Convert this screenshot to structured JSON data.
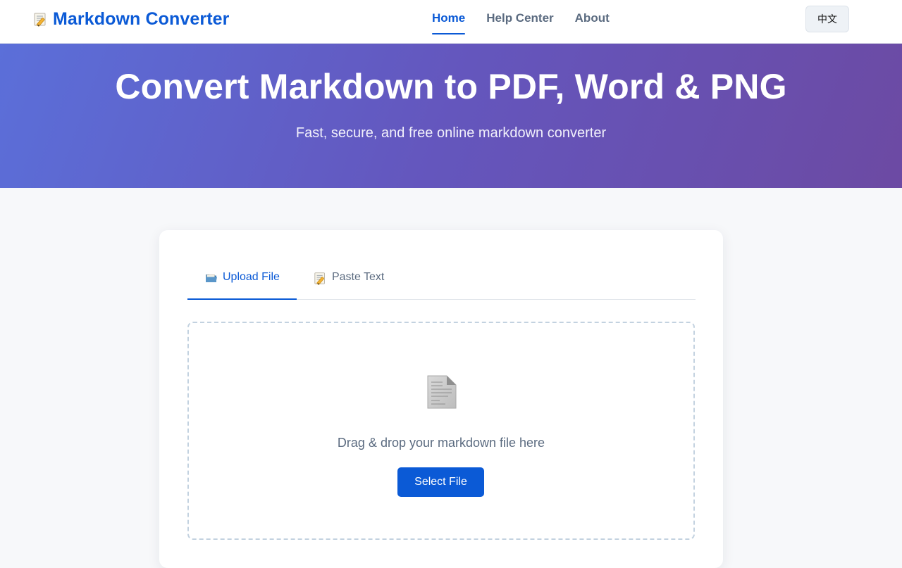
{
  "header": {
    "brand": {
      "icon": "memo-pencil-icon",
      "title": "Markdown Converter"
    },
    "nav": [
      {
        "label": "Home",
        "active": true
      },
      {
        "label": "Help Center",
        "active": false
      },
      {
        "label": "About",
        "active": false
      }
    ],
    "language_button": "中文"
  },
  "hero": {
    "title": "Convert Markdown to PDF, Word & PNG",
    "subtitle": "Fast, secure, and free online markdown converter"
  },
  "converter": {
    "tabs": [
      {
        "icon": "folder-icon",
        "label": "Upload File",
        "active": true
      },
      {
        "icon": "memo-pencil-icon",
        "label": "Paste Text",
        "active": false
      }
    ],
    "upload": {
      "icon": "document-icon",
      "instruction": "Drag & drop your markdown file here",
      "select_button": "Select File"
    }
  },
  "colors": {
    "accent": "#0b5ad6",
    "hero_gradient_start": "#5b6fd9",
    "hero_gradient_end": "#6c4aa3",
    "muted_text": "#5b6b80",
    "page_background": "#f7f8fa"
  }
}
